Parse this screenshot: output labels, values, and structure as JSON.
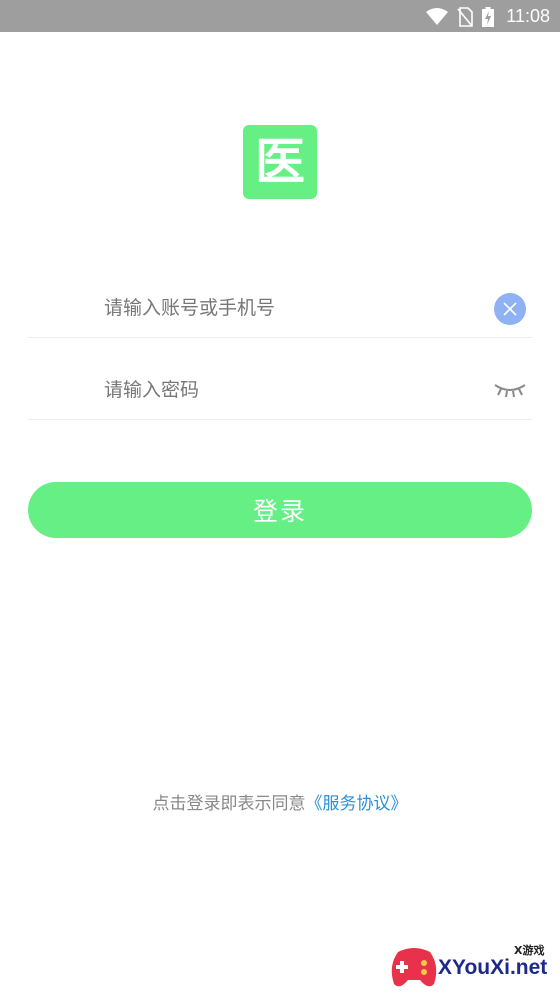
{
  "status_bar": {
    "time": "11:08",
    "icons": [
      "wifi-icon",
      "no-sim-icon",
      "battery-charging-icon"
    ]
  },
  "app": {
    "logo_glyph": "医",
    "logo_color": "#66ef85"
  },
  "login_form": {
    "account_placeholder": "请输入账号或手机号",
    "account_value": "",
    "password_placeholder": "请输入密码",
    "password_value": "",
    "login_label": "登录"
  },
  "agreement": {
    "prefix": "点击登录即表示同意",
    "link": "《服务协议》"
  },
  "watermark": {
    "small_text": "X游戏",
    "text": "XYouXi.net"
  },
  "colors": {
    "accent_green": "#66ef85",
    "clear_button": "#8fb2f5",
    "link_blue": "#2e8fd6"
  }
}
